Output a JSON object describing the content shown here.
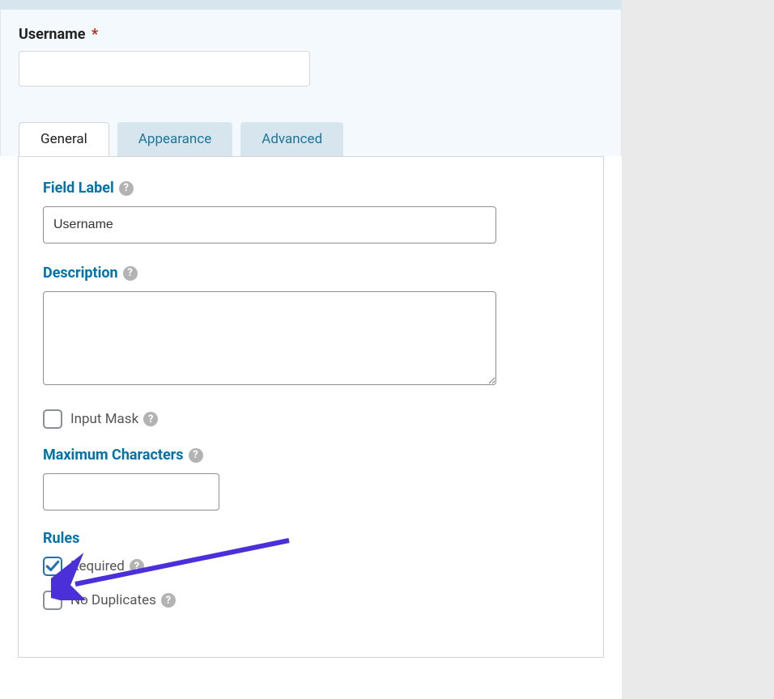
{
  "preview": {
    "label": "Username",
    "required_marker": "*"
  },
  "tabs": {
    "general": "General",
    "appearance": "Appearance",
    "advanced": "Advanced"
  },
  "general": {
    "field_label_heading": "Field Label",
    "field_label_value": "Username",
    "description_heading": "Description",
    "description_value": "",
    "input_mask_label": "Input Mask",
    "input_mask_checked": false,
    "max_chars_heading": "Maximum Characters",
    "max_chars_value": "",
    "rules_heading": "Rules",
    "required_label": "Required",
    "required_checked": true,
    "no_duplicates_label": "No Duplicates",
    "no_duplicates_checked": false
  },
  "help": "?"
}
